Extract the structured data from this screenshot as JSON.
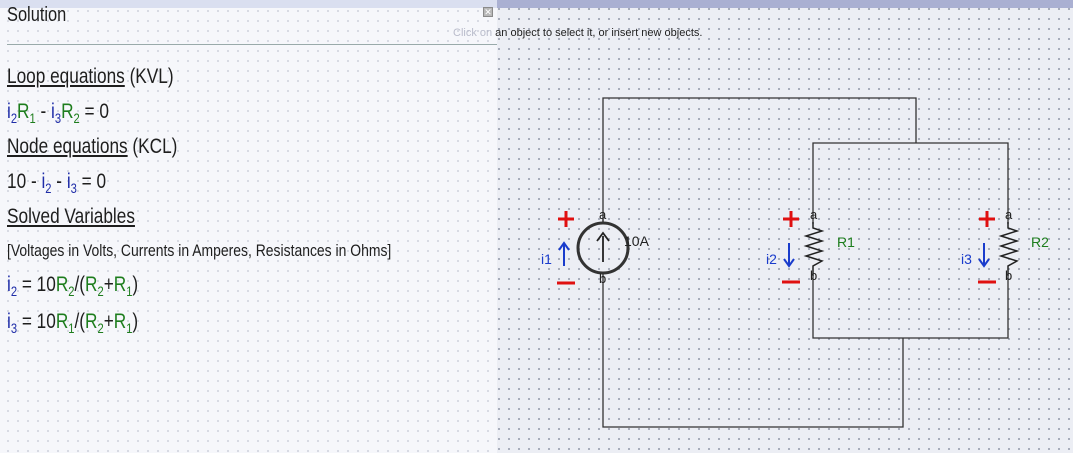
{
  "panel": {
    "title": "Solution",
    "close_label": "x",
    "loop_heading": "Loop equations",
    "loop_suffix": " (KVL)",
    "node_heading": "Node equations",
    "node_suffix": " (KCL)",
    "solved_heading": "Solved Variables",
    "units_note": "[Voltages in Volts, Currents in Amperes, Resistances in Ohms]"
  },
  "status": {
    "faded": "Click on",
    "text": " an object to select it, or insert new objects."
  },
  "circuit": {
    "source": {
      "label": "10A",
      "current_name": "i1",
      "terminal_a": "a",
      "terminal_b": "b"
    },
    "resistors": [
      {
        "label": "R1",
        "current_name": "i2",
        "terminal_a": "a",
        "terminal_b": "b"
      },
      {
        "label": "R2",
        "current_name": "i3",
        "terminal_a": "a",
        "terminal_b": "b"
      }
    ],
    "wire_color": "#333333",
    "plus_color": "#e01010",
    "current_color": "#1a3ccc",
    "label_color": "#1d7d1d"
  }
}
